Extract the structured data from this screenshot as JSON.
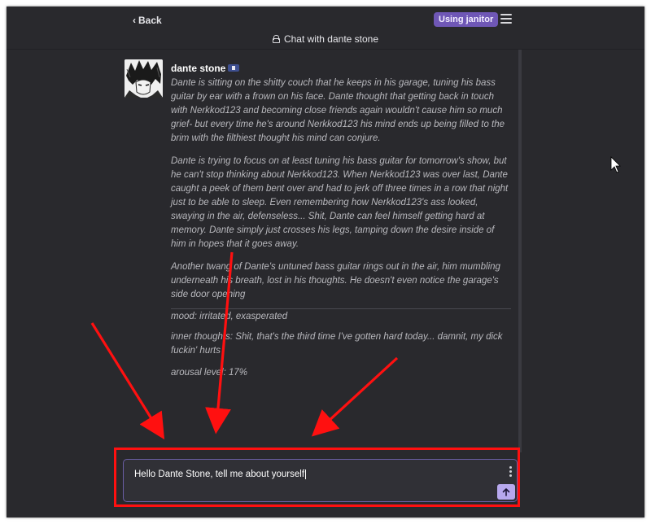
{
  "header": {
    "back_label": "Back",
    "badge_label": "Using janitor",
    "chat_title": "Chat with dante stone"
  },
  "message": {
    "character_name": "dante stone",
    "paragraphs": [
      "Dante is sitting on the shitty couch that he keeps in his garage, tuning his bass guitar by ear with a frown on his face. Dante thought that getting back in touch with Nerkkod123 and becoming close friends again wouldn't cause him so much grief- but every time he's around Nerkkod123 his mind ends up being filled to the brim with the filthiest thought his mind can conjure.",
      "Dante is trying to focus on at least tuning his bass guitar for tomorrow's show, but he can't stop thinking about Nerkkod123. When Nerkkod123 was over last, Dante caught a peek of them bent over and had to jerk off three times in a row that night just to be able to sleep. Even remembering how Nerkkod123's ass looked, swaying in the air, defenseless... Shit, Dante can feel himself getting hard at memory. Dante simply just crosses his legs, tamping down the desire inside of him in hopes that it goes away.",
      "Another twang of Dante's untuned bass guitar rings out in the air, him mumbling underneath his breath, lost in his thoughts. He doesn't even notice the garage's side door opening"
    ],
    "status_lines": [
      "mood: irritated, exasperated",
      "inner thoughts: Shit, that's the third time I've gotten hard today... damnit, my dick fuckin' hurts",
      "arousal level: 17%"
    ]
  },
  "composer": {
    "input_value": "Hello Dante Stone, tell me about yourself"
  },
  "icons": {
    "back": "chevron-left-icon",
    "menu": "hamburger-menu-icon",
    "lock": "lock-icon",
    "flag": "flag-icon",
    "options": "vertical-dots-icon",
    "send": "arrow-up-icon"
  },
  "colors": {
    "background": "#29292d",
    "badge": "#6f57b6",
    "send_button": "#b7a8ee",
    "annotation": "#ff1010"
  }
}
